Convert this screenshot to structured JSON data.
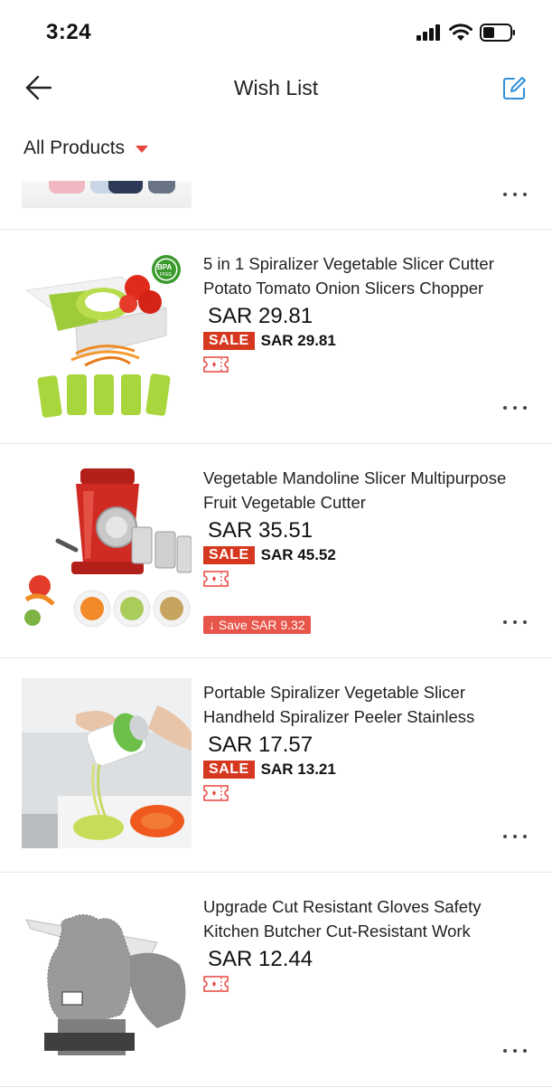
{
  "status": {
    "time": "3:24"
  },
  "header": {
    "title": "Wish List"
  },
  "filter": {
    "label": "All Products"
  },
  "items": [
    {
      "title": "5 in 1 Spiralizer Vegetable Slicer Cutter Potato Tomato Onion Slicers Chopper",
      "price": "SAR 29.81",
      "sale_label": "SALE",
      "sale_price": "SAR 29.81",
      "thumb_badge": "BPA",
      "thumb_badge_sub": "FREE"
    },
    {
      "title": "Vegetable Mandoline Slicer Multipurpose Fruit Vegetable Cutter",
      "price": "SAR 35.51",
      "sale_label": "SALE",
      "sale_price": "SAR 45.52",
      "save": "↓ Save SAR 9.32"
    },
    {
      "title": "Portable Spiralizer Vegetable Slicer Handheld Spiralizer Peeler Stainless",
      "price": "SAR 17.57",
      "sale_label": "SALE",
      "sale_price": "SAR 13.21"
    },
    {
      "title": "Upgrade Cut Resistant Gloves Safety Kitchen Butcher Cut-Resistant Work",
      "price": "SAR 12.44"
    }
  ],
  "colors": {
    "accent": "#e8453c",
    "sale": "#d6371f",
    "edit_icon": "#2f8fd8"
  }
}
